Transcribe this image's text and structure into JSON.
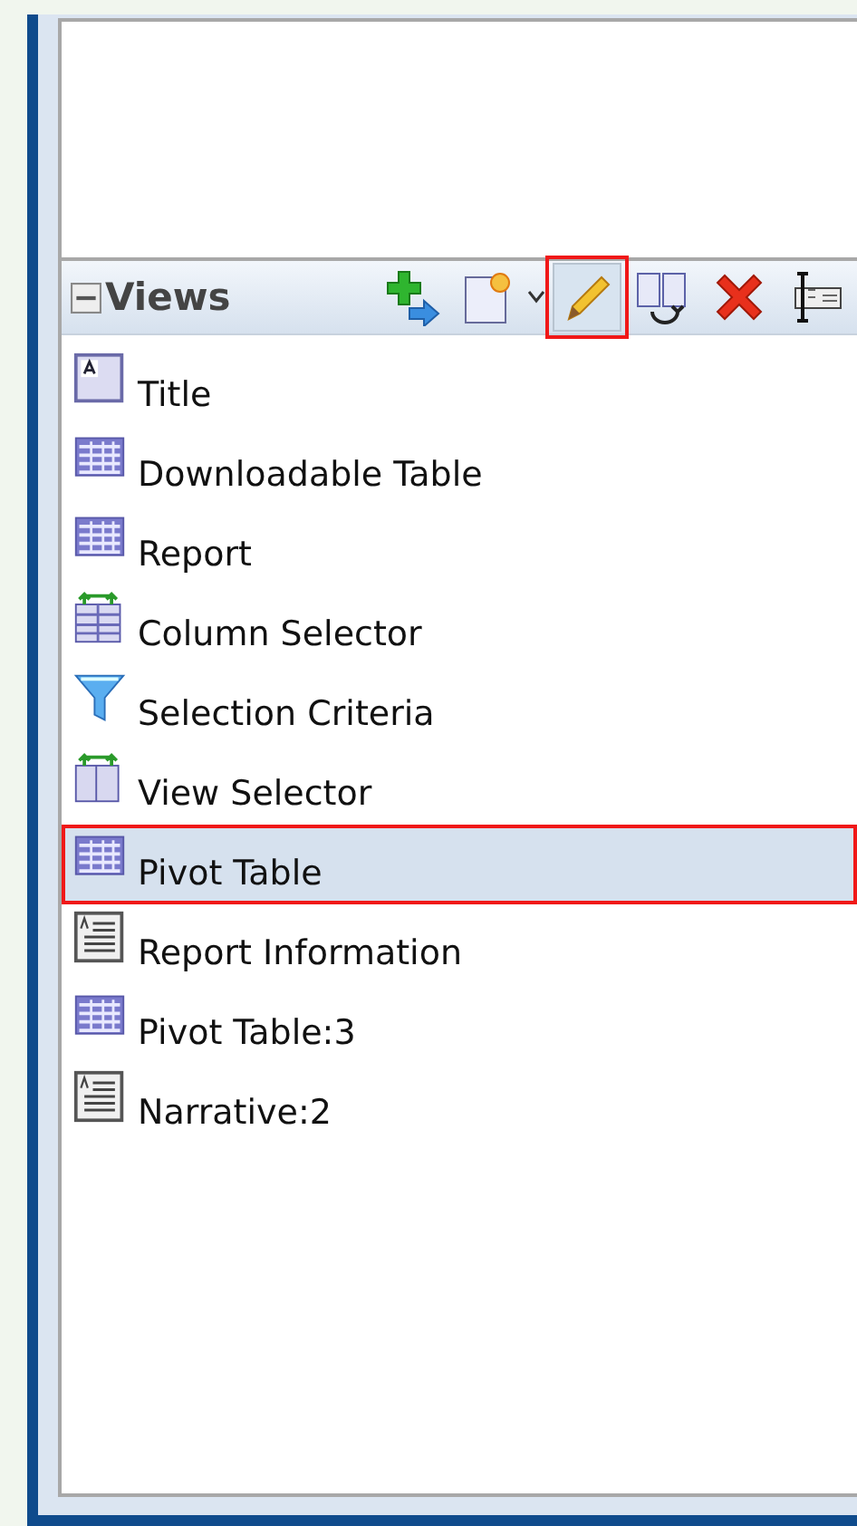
{
  "panel": {
    "title": "Views",
    "expanded": true
  },
  "toolbar": [
    {
      "kind": "add",
      "highlighted": false
    },
    {
      "kind": "new",
      "highlighted": false
    },
    {
      "kind": "edit",
      "highlighted": true
    },
    {
      "kind": "duplicate",
      "highlighted": false
    },
    {
      "kind": "delete",
      "highlighted": false
    },
    {
      "kind": "rename",
      "highlighted": false
    }
  ],
  "items": [
    {
      "label": "Title",
      "kind": "title",
      "selected": false
    },
    {
      "label": "Downloadable Table",
      "kind": "table",
      "selected": false
    },
    {
      "label": "Report",
      "kind": "table",
      "selected": false
    },
    {
      "label": "Column Selector",
      "kind": "column-selector",
      "selected": false
    },
    {
      "label": "Selection Criteria",
      "kind": "filter",
      "selected": false
    },
    {
      "label": "View Selector",
      "kind": "view-selector",
      "selected": false
    },
    {
      "label": "Pivot Table",
      "kind": "table",
      "selected": true
    },
    {
      "label": "Report Information",
      "kind": "info",
      "selected": false
    },
    {
      "label": "Pivot Table:3",
      "kind": "table",
      "selected": false
    },
    {
      "label": "Narrative:2",
      "kind": "info",
      "selected": false
    }
  ]
}
